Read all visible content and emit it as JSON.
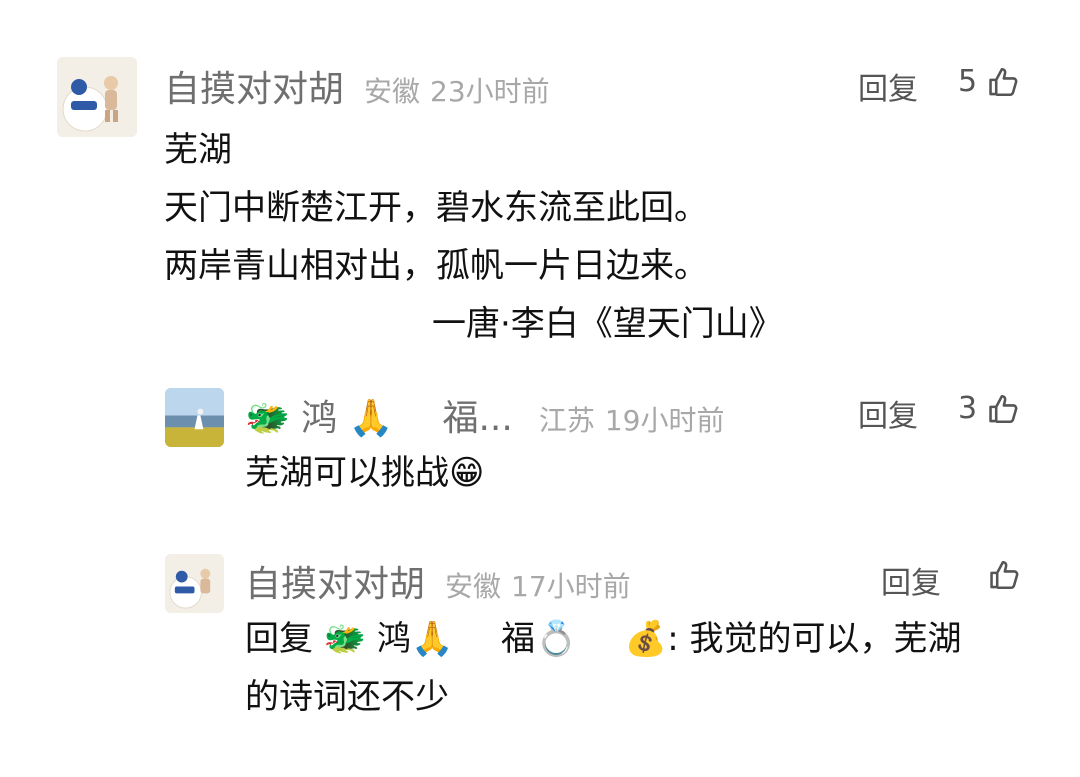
{
  "comments": [
    {
      "username": "自摸对对胡",
      "location": "安徽",
      "time": "23小时前",
      "reply_label": "回复",
      "likes": "5",
      "body_lines": [
        "芜湖",
        "天门中断楚江开，碧水东流至此回。",
        "两岸青山相对出，孤帆一片日边来。"
      ],
      "signature": "一唐·李白《望天门山》"
    },
    {
      "username_emoji_1": "🐲",
      "username_part_1": "鸿",
      "username_emoji_2": "🙏",
      "username_part_2": "福...",
      "location": "江苏",
      "time": "19小时前",
      "reply_label": "回复",
      "likes": "3",
      "body_text": "芜湖可以挑战",
      "body_emoji": "😁"
    },
    {
      "username": "自摸对对胡",
      "location": "安徽",
      "time": "17小时前",
      "reply_label": "回复",
      "likes": "",
      "body_prefix": "回复",
      "mention_emoji_1": "🐲",
      "mention_part_1": "鸿",
      "mention_emoji_2": "🙏",
      "mention_part_2": "福",
      "mention_emoji_3": "💍",
      "mention_emoji_4": "💰",
      "body_rest_line1": ": 我觉的可以，芜湖",
      "body_rest_line2": "的诗词还不少"
    }
  ],
  "icons": {
    "like": "thumbs-up-outline-icon"
  },
  "colors": {
    "username": "#6f6f6f",
    "meta": "#a8a8a8",
    "body": "#111111",
    "action": "#555555",
    "background": "#ffffff"
  }
}
